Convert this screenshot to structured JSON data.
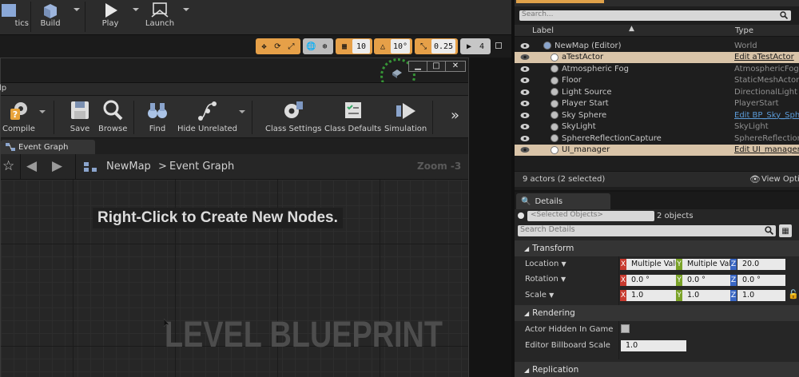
{
  "top_toolbar": {
    "partial_label": "tics",
    "build": "Build",
    "play": "Play",
    "launch": "Launch"
  },
  "viewport_toolbar": {
    "grid_snap": "10",
    "rotation_snap": "10°",
    "scale_snap": "0.25",
    "camera_speed": "4"
  },
  "blueprint_editor": {
    "menu_partial": "lp",
    "toolbar": {
      "compile": "Compile",
      "save": "Save",
      "browse": "Browse",
      "find": "Find",
      "hide_unrelated": "Hide Unrelated",
      "class_settings": "Class Settings",
      "class_defaults": "Class Defaults",
      "simulation": "Simulation",
      "overflow": "»"
    },
    "tab": "Event Graph",
    "breadcrumb": {
      "root": "NewMap",
      "separator": ">",
      "current": "Event Graph"
    },
    "zoom": "Zoom -3",
    "hint": "Right-Click to Create New Nodes.",
    "watermark": "LEVEL BLUEPRINT",
    "window_buttons": {
      "minimize": "▁",
      "maximize": "□",
      "close": "✕"
    }
  },
  "world_outliner": {
    "search_placeholder": "Search...",
    "col_label": "Label",
    "col_type": "Type",
    "rows": [
      {
        "name": "NewMap (Editor)",
        "type": "World",
        "selected": false,
        "link": false
      },
      {
        "name": "aTestActor",
        "type": "Edit aTestActor",
        "selected": true,
        "link": true
      },
      {
        "name": "Atmospheric Fog",
        "type": "AtmosphericFog",
        "selected": false,
        "link": false
      },
      {
        "name": "Floor",
        "type": "StaticMeshActor",
        "selected": false,
        "link": false
      },
      {
        "name": "Light Source",
        "type": "DirectionalLight",
        "selected": false,
        "link": false
      },
      {
        "name": "Player Start",
        "type": "PlayerStart",
        "selected": false,
        "link": false
      },
      {
        "name": "Sky Sphere",
        "type": "Edit BP_Sky_Sphere",
        "selected": false,
        "link": true
      },
      {
        "name": "SkyLight",
        "type": "SkyLight",
        "selected": false,
        "link": false
      },
      {
        "name": "SphereReflectionCapture",
        "type": "SphereReflectionCa",
        "selected": false,
        "link": false
      },
      {
        "name": "UI_manager",
        "type": "Edit UI_manager",
        "selected": true,
        "link": true
      }
    ],
    "status": "9 actors (2 selected)",
    "view_options": "View Optio"
  },
  "details": {
    "tab": "Details",
    "selected_objects_placeholder": "<Selected Objects>",
    "objects_count": "2 objects",
    "search_placeholder": "Search Details",
    "transform": {
      "header": "Transform",
      "location_label": "Location",
      "location": [
        "Multiple Valu",
        "Multiple Valu",
        "20.0"
      ],
      "rotation_label": "Rotation",
      "rotation": [
        "0.0 °",
        "0.0 °",
        "0.0 °"
      ],
      "scale_label": "Scale",
      "scale": [
        "1.0",
        "1.0",
        "1.0"
      ]
    },
    "rendering": {
      "header": "Rendering",
      "actor_hidden_label": "Actor Hidden In Game",
      "actor_hidden_value": false,
      "billboard_scale_label": "Editor Billboard Scale",
      "billboard_scale_value": "1.0"
    },
    "replication_header": "Replication"
  },
  "colors": {
    "selection": "#d9c4a8",
    "accent_orange": "#e6a048",
    "link_blue": "#5b9bd8",
    "axis_x": "#c83a2f",
    "axis_y": "#7aa228",
    "axis_z": "#3a67c4"
  }
}
